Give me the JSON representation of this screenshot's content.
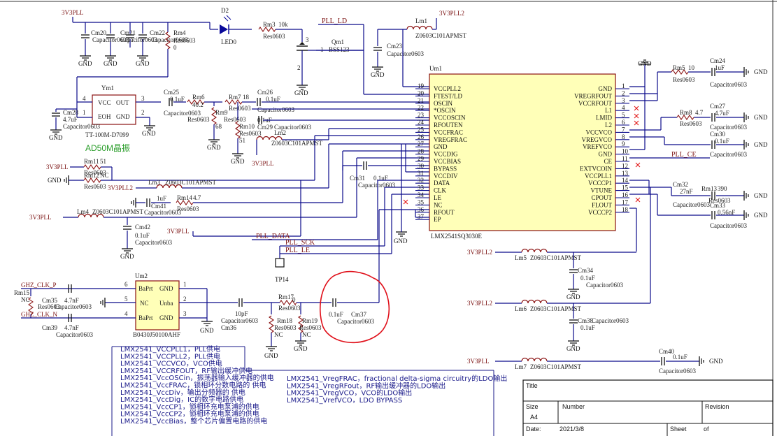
{
  "power_labels": {
    "vccpll_top": "3V3PLL",
    "vccpll2_top": "3V3PLL2",
    "vccpll_mid": "3V3PLL",
    "vccpll_l2": "3V3PLL",
    "vccpll_l3": "3V3PLL",
    "vccpll2_l2": "3V3PLL2",
    "vccpll_bot": "3V3PLL",
    "vccpll_r1": "3V3PLL2",
    "vccpll_r2": "3V3PLL2",
    "vccpll_r3": "3V3PLL",
    "vccpll_l4": "3V3PLL"
  },
  "gnd_label": "GND",
  "nets": {
    "pll_ld": "PLL_LD",
    "pll_data": "PLL_DATA",
    "pll_sck": "PLL_SCK",
    "pll_le": "PLL_LE",
    "pll_ce": "PLL_CE",
    "clk_p": "GHZ_CLK_P",
    "clk_n": "GHZ_CLK_N"
  },
  "components": {
    "d2": {
      "ref": "D2",
      "value": "LED0"
    },
    "rm3": {
      "ref": "Rm3",
      "value": "10k",
      "fp": "Res0603"
    },
    "qm1": {
      "ref": "Qm1",
      "value": "BSS123",
      "pin1": "1",
      "pin2": "2",
      "pin3": "3"
    },
    "lm1": {
      "ref": "Lm1",
      "value": "Z0603C101APMST"
    },
    "cm23": {
      "ref": "Cm23",
      "fp": "Capacitor0603"
    },
    "cm20": {
      "ref": "Cm20",
      "fp": "Capacitor0603"
    },
    "cm21": {
      "ref": "Cm21",
      "fp": "Capacitor0603"
    },
    "cm22": {
      "ref": "Cm22",
      "fp": "Capacitor0603"
    },
    "rm4": {
      "ref": "Rm4",
      "value": "0",
      "fp": "Res0603"
    },
    "ym1": {
      "ref": "Ym1",
      "value": "TT-100M-D7099",
      "pins": [
        "VCC",
        "OUT",
        "EOH",
        "GND"
      ],
      "nums": [
        "4",
        "3",
        "1",
        "2"
      ]
    },
    "cm28": {
      "ref": "Cm28",
      "value": "4.7uF",
      "fp": "Capacitor0603"
    },
    "cm25": {
      "ref": "Cm25",
      "value": "0.1uF",
      "fp": "Capacitor0603"
    },
    "rm6": {
      "ref": "Rm6",
      "value": "40.2",
      "fp": "Res0603"
    },
    "rm7": {
      "ref": "Rm7",
      "value": "18",
      "fp": "Res0603"
    },
    "rm9": {
      "ref": "Rm9",
      "value": "68",
      "fp": "Res0603"
    },
    "cm26": {
      "ref": "Cm26",
      "value": "0.1uF",
      "fp": "Capacitor0603"
    },
    "rm10": {
      "ref": "Rm10",
      "value": "51",
      "fp": "Res0603"
    },
    "cm29": {
      "ref": "Cm29",
      "value": "0.1uF",
      "fp": "Capacitor0603"
    },
    "lm2": {
      "ref": "Lm2",
      "value": "Z0603C101APMST"
    },
    "rm11": {
      "ref": "Rm11",
      "value": "51",
      "fp": "Res0603"
    },
    "rm12": {
      "ref": "Rm12",
      "value": "NC",
      "fp": "Res0603"
    },
    "lm3": {
      "ref": "Lm3",
      "value": "Z0603C101APMST"
    },
    "cm31": {
      "ref": "Cm31",
      "value": "0.1uF",
      "fp": "Capacitor0603"
    },
    "cm41": {
      "ref": "Cm41",
      "value": "1uF",
      "fp": "Capacitor0603"
    },
    "rm14": {
      "ref": "Rm14",
      "value": "4.7",
      "fp": "Res0603"
    },
    "lm4": {
      "ref": "Lm4",
      "value": "Z0603C101APMST"
    },
    "cm42": {
      "ref": "Cm42",
      "value": "0.1uF",
      "fp": "Capacitor0603"
    },
    "rm5": {
      "ref": "Rm5",
      "value": "10",
      "fp": "Res0603"
    },
    "cm24": {
      "ref": "Cm24",
      "value": "1uF",
      "fp": "Capacitor0603"
    },
    "rm8": {
      "ref": "Rm8",
      "value": "4.7",
      "fp": "Res0603"
    },
    "cm27": {
      "ref": "Cm27",
      "value": "4.7uF",
      "fp": "Capacitor0603"
    },
    "cm30": {
      "ref": "Cm30",
      "value": "0.1uF",
      "fp": "Capacitor0603"
    },
    "cm32": {
      "ref": "Cm32",
      "value": "27nF",
      "fp": "Capacitor0603"
    },
    "rm13": {
      "ref": "Rm13",
      "value": "390",
      "fp": "Res0603"
    },
    "cm33": {
      "ref": "Cm33",
      "value": "0.56nF",
      "fp": "Capacitor0603"
    },
    "lm5": {
      "ref": "Lm5",
      "value": "Z0603C101APMST"
    },
    "cm34": {
      "ref": "Cm34",
      "value": "0.1uF",
      "fp": "Capacitor0603"
    },
    "lm6": {
      "ref": "Lm6",
      "value": "Z0603C101APMST"
    },
    "cm38": {
      "ref": "Cm38",
      "value": "0.1uF",
      "fp": "Capacitor0603"
    },
    "lm7": {
      "ref": "Lm7",
      "value": "Z0603C101APMST"
    },
    "cm40": {
      "ref": "Cm40",
      "value": "0.1uF",
      "fp": "Capacitor0603"
    },
    "um2": {
      "ref": "Um2",
      "value": "B0430J50100AHF",
      "pins": [
        "BaPrt",
        "GND",
        "NC",
        "Unba",
        "BaPrt",
        "GND"
      ],
      "nums": [
        "6",
        "1",
        "5",
        "2",
        "4",
        "3"
      ]
    },
    "rm15": {
      "ref": "Rm15",
      "value": "NC",
      "fp": "Res0603"
    },
    "cm35": {
      "ref": "Cm35",
      "value": "4.7nF",
      "fp": "Capacitor0603"
    },
    "cm39": {
      "ref": "Cm39",
      "value": "4.7nF",
      "fp": "Capacitor0603"
    },
    "cm36": {
      "ref": "Cm36",
      "value": "10pF",
      "fp": "Capacitor0603"
    },
    "rm17": {
      "ref": "Rm17",
      "value": "0",
      "fp": "Res0603"
    },
    "rm18": {
      "ref": "Rm18",
      "value": "NC",
      "fp": "Res0603"
    },
    "rm19": {
      "ref": "Rm19",
      "value": "NC",
      "fp": "Res0603"
    },
    "cm37": {
      "ref": "Cm37",
      "value": "0.1uF",
      "fp": "Capacitor0603"
    },
    "tp14": {
      "ref": "TP14"
    }
  },
  "crystal_note": "AD50M晶振",
  "um1": {
    "ref": "Um1",
    "value": "LMX2541SQ3030E",
    "left_pins": [
      {
        "num": "19",
        "name": "VCCPLL2"
      },
      {
        "num": "20",
        "name": "FTEST/LD"
      },
      {
        "num": "21",
        "name": "OSCIN"
      },
      {
        "num": "22",
        "name": "*OSCIN"
      },
      {
        "num": "23",
        "name": "VCCOSCIN"
      },
      {
        "num": "24",
        "name": "RFOUTEN"
      },
      {
        "num": "25",
        "name": "VCCFRAC"
      },
      {
        "num": "26",
        "name": "VREGFRAC"
      },
      {
        "num": "27",
        "name": "GND"
      },
      {
        "num": "28",
        "name": "VCCDIG"
      },
      {
        "num": "29",
        "name": "VCCBIAS"
      },
      {
        "num": "30",
        "name": "BYPASS"
      },
      {
        "num": "31",
        "name": "VCCDIV"
      },
      {
        "num": "32",
        "name": "DATA"
      },
      {
        "num": "33",
        "name": "CLK"
      },
      {
        "num": "34",
        "name": "LE"
      },
      {
        "num": "35",
        "name": "NC"
      },
      {
        "num": "36",
        "name": "RFOUT"
      },
      {
        "num": "37",
        "name": "EP"
      }
    ],
    "right_pins": [
      {
        "num": "1",
        "name": "GND"
      },
      {
        "num": "2",
        "name": "VREGRFOUT"
      },
      {
        "num": "3",
        "name": "VCCRFOUT"
      },
      {
        "num": "4",
        "name": "L1"
      },
      {
        "num": "5",
        "name": "LMID"
      },
      {
        "num": "6",
        "name": "L2"
      },
      {
        "num": "7",
        "name": "VCCVCO"
      },
      {
        "num": "8",
        "name": "VREGVCO"
      },
      {
        "num": "9",
        "name": "VREFVCO"
      },
      {
        "num": "10",
        "name": "GND"
      },
      {
        "num": "11",
        "name": "CE"
      },
      {
        "num": "12",
        "name": "EXTVCOIN"
      },
      {
        "num": "13",
        "name": "VCCPLL1"
      },
      {
        "num": "14",
        "name": "VCCCP1"
      },
      {
        "num": "15",
        "name": "VTUNE"
      },
      {
        "num": "16",
        "name": "CPOUT"
      },
      {
        "num": "17",
        "name": "FLOUT"
      },
      {
        "num": "18",
        "name": "VCCCP2"
      }
    ]
  },
  "notes": {
    "col1": [
      "LMX2541_VCCPLL1，PLL供电",
      "LMX2541_VCCPLL2，PLL供电",
      "LMX2541_VCCVCO，VCO供电",
      "LMX2541_VCCRFOUT，RF输出缓冲供电",
      "LMX2541_VccOSCin，振荡器输入缓冲器的供电",
      "LMX2541_VccFRAC，锁相环分数电路的 供电",
      "LMX2541_VccDiv，输出分频器的 供电",
      "LMX2541_VccDig，IC的数字电路供电",
      "LMX2541_VccCP1，锁相环充电泵浦的供电",
      "LMX2541_VccCP2，锁相环充电泵浦的供电",
      "LMX2541_VccBias，整个芯片偏置电路的供电"
    ],
    "col2": [
      "LMX2541_VregFRAC，fractional delta-sigma circuitry的LDO输出",
      "LMX2541_VregRFout，RF输出缓冲器的LDO输出",
      "LMX2541_VregVCO，VCO的LDO输出",
      "LMX2541_VrefVCO，LDO BYPASS"
    ]
  },
  "title_block": {
    "title_label": "Title",
    "size_label": "Size",
    "size_value": "A4",
    "number_label": "Number",
    "revision_label": "Revision",
    "date_label": "Date:",
    "date_value": "2021/3/8",
    "sheet_label": "Sheet",
    "of_label": "of"
  },
  "colors": {
    "wire": "#0a0a8a",
    "component": "#8a1010",
    "ic_fill": "#ffffb8",
    "highlight": "#e0101a",
    "crystal_note": "#2a9d2a"
  }
}
